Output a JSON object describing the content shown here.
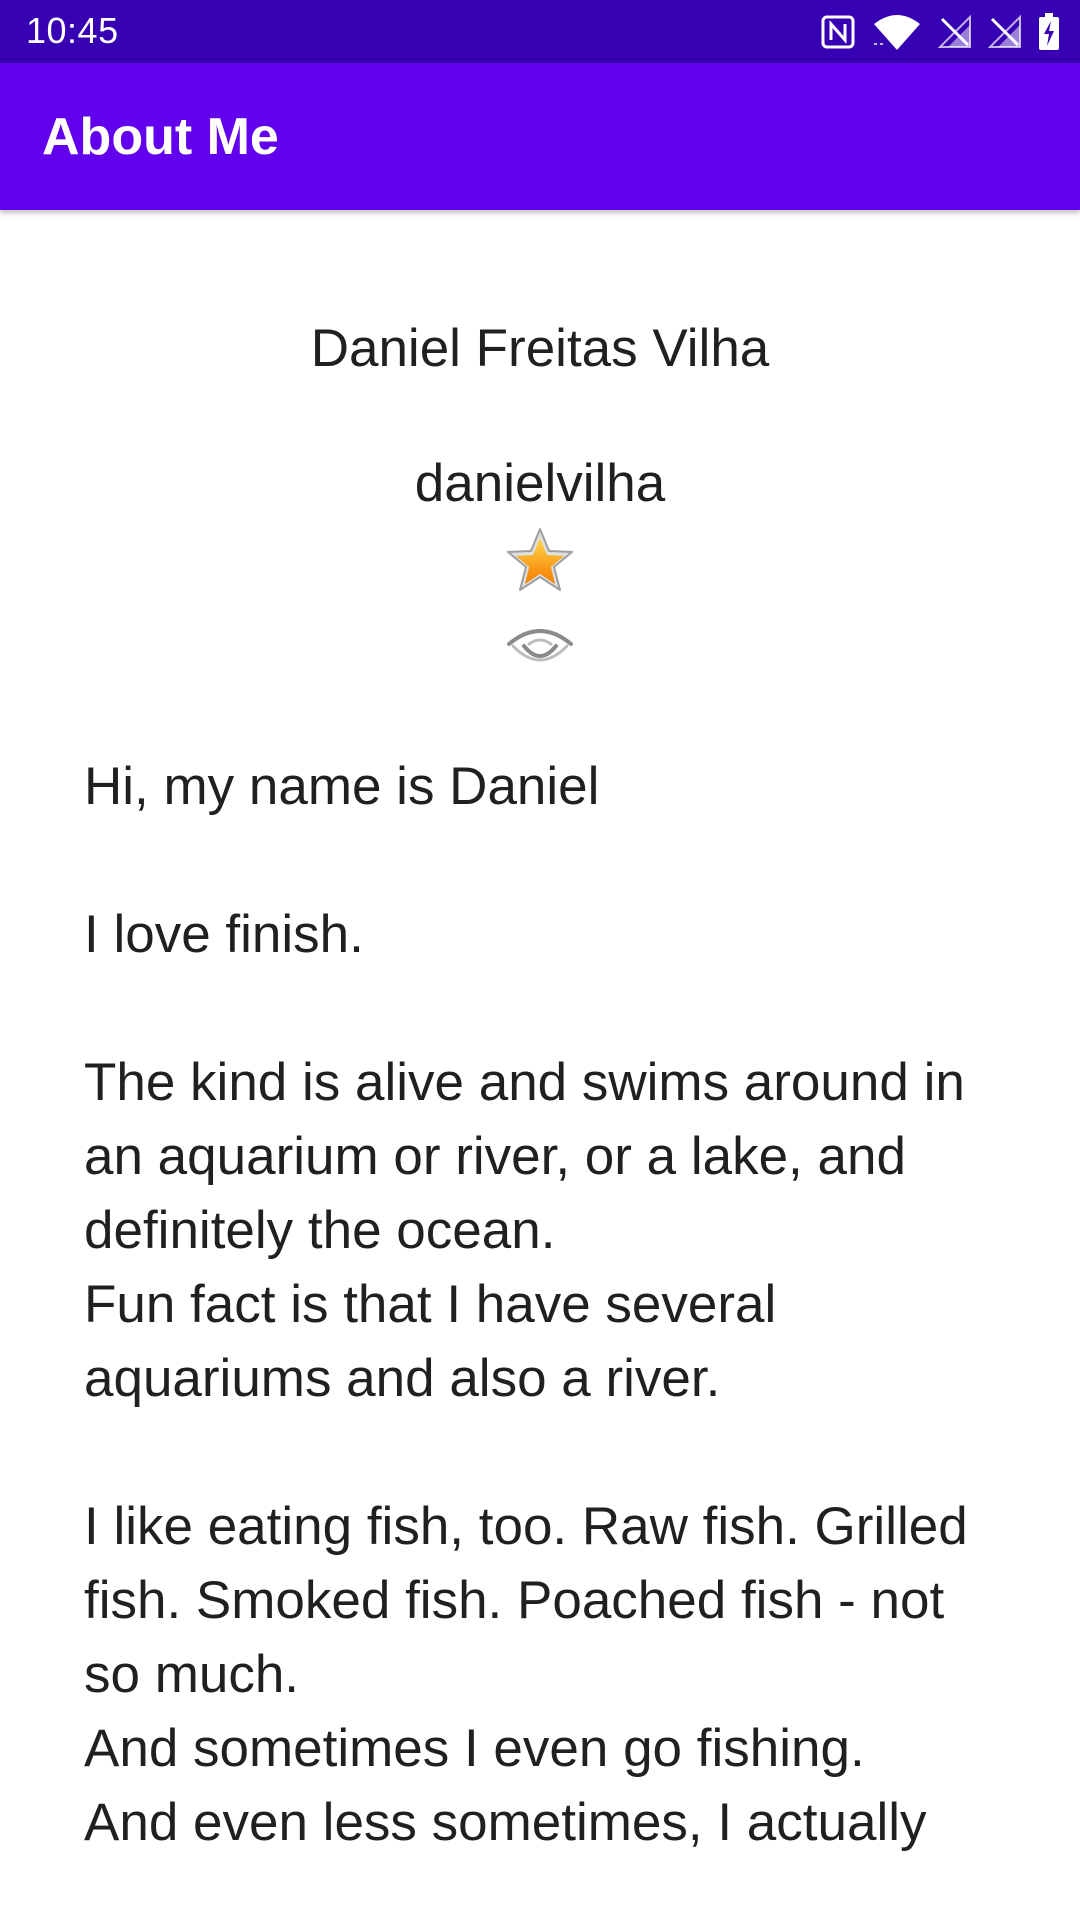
{
  "status_bar": {
    "time": "10:45",
    "icons": [
      "nfc-icon",
      "wifi-icon",
      "signal-off-icon",
      "signal-off-icon",
      "battery-charging-icon"
    ]
  },
  "app_bar": {
    "title": "About Me"
  },
  "profile": {
    "name": "Daniel Freitas Vilha",
    "nickname": "danielvilha",
    "star_icon": "star-icon",
    "eye_icon": "eye-icon"
  },
  "bio": {
    "text": "Hi, my name is Daniel\n\nI love finish.\n\nThe kind is alive and swims around in an aquarium or river, or a lake, and definitely the ocean.\nFun fact is that I have several aquariums and also a river.\n\nI like eating fish, too. Raw fish. Grilled fish. Smoked fish. Poached fish - not so much.\nAnd sometimes I even go fishing.\nAnd even less sometimes, I actually"
  },
  "colors": {
    "status_bar": "#3700b3",
    "app_bar": "#6200ee",
    "star_fill": "#f5a623",
    "background": "#ffffff"
  }
}
